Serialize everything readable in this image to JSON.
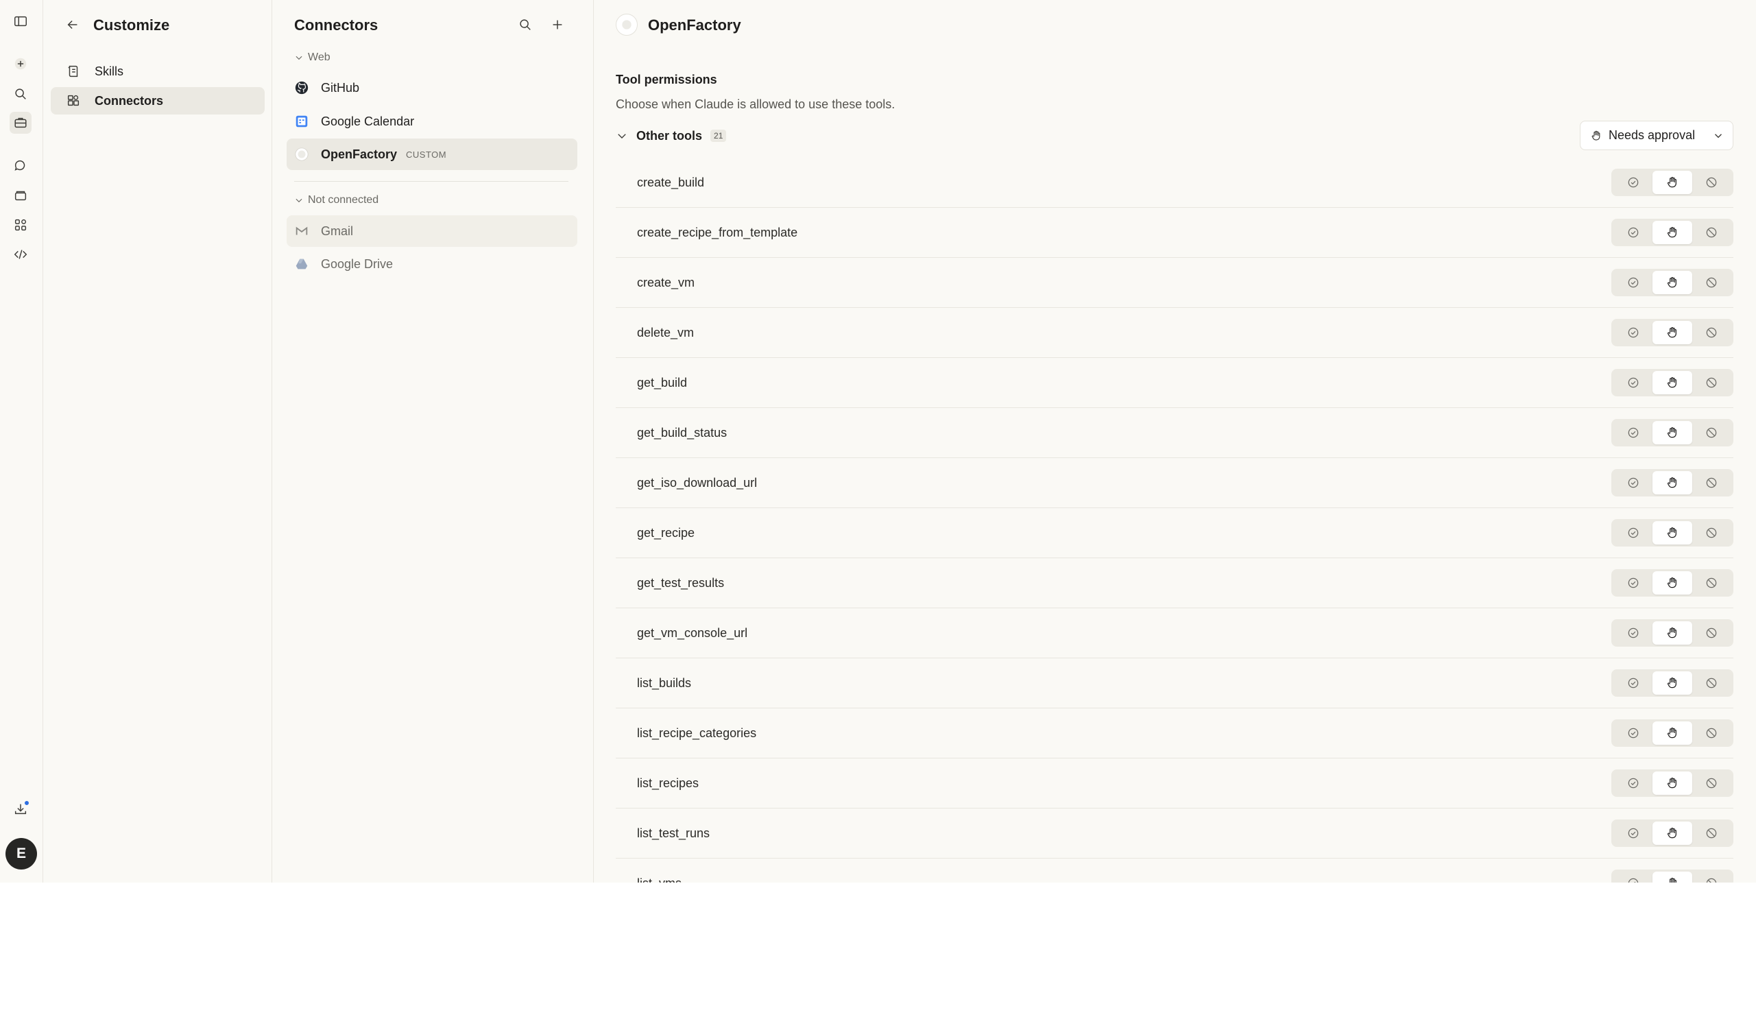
{
  "rail": {
    "items": [
      {
        "name": "sidebar-toggle-icon",
        "active": false
      },
      {
        "name": "new-chat-icon",
        "active": false
      },
      {
        "name": "search-icon",
        "active": false
      },
      {
        "name": "customize-icon",
        "active": true
      },
      {
        "name": "chats-icon",
        "active": false
      },
      {
        "name": "projects-icon",
        "active": false
      },
      {
        "name": "artifacts-icon",
        "active": false
      },
      {
        "name": "code-icon",
        "active": false
      }
    ],
    "download_icon": "download-icon",
    "avatar_initial": "E"
  },
  "customize": {
    "title": "Customize",
    "nav": [
      {
        "label": "Skills",
        "icon": "skills-icon",
        "active": false
      },
      {
        "label": "Connectors",
        "icon": "connectors-icon",
        "active": true
      }
    ]
  },
  "connectors": {
    "title": "Connectors",
    "groups": [
      {
        "label": "Web",
        "items": [
          {
            "label": "GitHub",
            "icon": "github-icon",
            "badge": "",
            "state": "normal"
          },
          {
            "label": "Google Calendar",
            "icon": "google-calendar-icon",
            "badge": "",
            "state": "normal"
          },
          {
            "label": "OpenFactory",
            "icon": "openfactory-icon",
            "badge": "CUSTOM",
            "state": "selected"
          }
        ]
      },
      {
        "label": "Not connected",
        "items": [
          {
            "label": "Gmail",
            "icon": "gmail-icon",
            "badge": "",
            "state": "hover"
          },
          {
            "label": "Google Drive",
            "icon": "google-drive-icon",
            "badge": "",
            "state": "normal"
          }
        ]
      }
    ]
  },
  "detail": {
    "title": "OpenFactory",
    "permissions_heading": "Tool permissions",
    "permissions_desc": "Choose when Claude is allowed to use these tools.",
    "group_label": "Other tools",
    "group_count": "21",
    "approval_value": "Needs approval",
    "tools": [
      {
        "name": "create_build",
        "mode": "needs-approval"
      },
      {
        "name": "create_recipe_from_template",
        "mode": "needs-approval"
      },
      {
        "name": "create_vm",
        "mode": "needs-approval"
      },
      {
        "name": "delete_vm",
        "mode": "needs-approval"
      },
      {
        "name": "get_build",
        "mode": "needs-approval"
      },
      {
        "name": "get_build_status",
        "mode": "needs-approval"
      },
      {
        "name": "get_iso_download_url",
        "mode": "needs-approval"
      },
      {
        "name": "get_recipe",
        "mode": "needs-approval"
      },
      {
        "name": "get_test_results",
        "mode": "needs-approval"
      },
      {
        "name": "get_vm_console_url",
        "mode": "needs-approval"
      },
      {
        "name": "list_builds",
        "mode": "needs-approval"
      },
      {
        "name": "list_recipe_categories",
        "mode": "needs-approval"
      },
      {
        "name": "list_recipes",
        "mode": "needs-approval"
      },
      {
        "name": "list_test_runs",
        "mode": "needs-approval"
      },
      {
        "name": "list_vms",
        "mode": "needs-approval"
      }
    ]
  }
}
